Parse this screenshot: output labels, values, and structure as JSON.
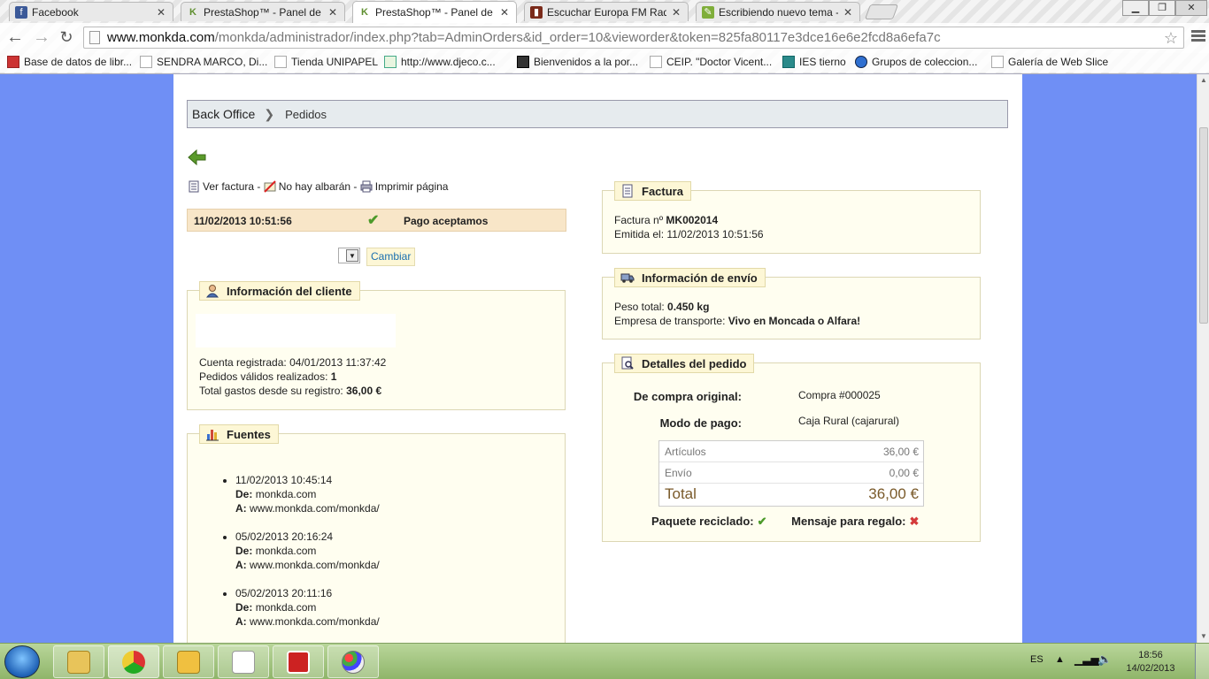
{
  "browser": {
    "tabs": [
      {
        "title": "Facebook",
        "icon": "facebook-icon",
        "color": "#3b5998",
        "glyph": "f"
      },
      {
        "title": "PrestaShop™ - Panel de ad",
        "icon": "prestashop-icon",
        "color": "#5f8f2f",
        "glyph": "K"
      },
      {
        "title": "PrestaShop™ - Panel de ad",
        "icon": "prestashop-icon",
        "color": "#5f8f2f",
        "glyph": "K"
      },
      {
        "title": "Escuchar Europa FM Radio",
        "icon": "radio-icon",
        "color": "#7a2a1a",
        "glyph": "▮"
      },
      {
        "title": "Escribiendo nuevo tema -",
        "icon": "forum-icon",
        "color": "#7fae3a",
        "glyph": "✎"
      }
    ],
    "url_host": "www.monkda.com",
    "url_rest": "/monkda/administrador/index.php?tab=AdminOrders&id_order=10&vieworder&token=825fa80117e3dce16e6e2fcd8a6efa7c",
    "bookmarks": [
      "Base de datos de libr...",
      "SENDRA MARCO, Di...",
      "Tienda UNIPAPEL",
      "http://www.djeco.c...",
      "Bienvenidos a la por...",
      "CEIP. \"Doctor Vicent...",
      "IES tierno",
      "Grupos de coleccion...",
      "Galería de Web Slice"
    ]
  },
  "page": {
    "breadcrumb": {
      "root": "Back Office",
      "current": "Pedidos"
    },
    "actions": {
      "invoice": "Ver factura",
      "sep1": " - ",
      "no_delivery": "No hay albarán",
      "sep2": " - ",
      "print": "Imprimir página"
    },
    "status": {
      "date": "11/02/2013 10:51:56",
      "label": "Pago aceptamos"
    },
    "change_button": "Cambiar",
    "customer": {
      "title": "Información del cliente",
      "registered_label": "Cuenta registrada:",
      "registered_value": "04/01/2013 11:37:42",
      "orders_label": "Pedidos válidos realizados:",
      "orders_value": "1",
      "spent_label": "Total gastos desde su registro:",
      "spent_value": "36,00 €"
    },
    "sources": {
      "title": "Fuentes",
      "from_label": "De:",
      "to_label": "A:",
      "items": [
        {
          "date": "11/02/2013 10:45:14",
          "from": "monkda.com",
          "to": "www.monkda.com/monkda/"
        },
        {
          "date": "05/02/2013 20:16:24",
          "from": "monkda.com",
          "to": "www.monkda.com/monkda/"
        },
        {
          "date": "05/02/2013 20:11:16",
          "from": "monkda.com",
          "to": "www.monkda.com/monkda/"
        }
      ]
    },
    "invoice": {
      "title": "Factura",
      "number_label": "Factura nº",
      "number_value": "MK002014",
      "issued_label": "Emitida el:",
      "issued_value": "11/02/2013 10:51:56"
    },
    "shipping": {
      "title": "Información de envío",
      "weight_label": "Peso total:",
      "weight_value": "0.450 kg",
      "carrier_label": "Empresa de transporte:",
      "carrier_value": "Vivo en Moncada o Alfara!"
    },
    "details": {
      "title": "Detalles del pedido",
      "original_label": "De compra original:",
      "original_value": "Compra #000025",
      "payment_label": "Modo de pago:",
      "payment_value": "Caja Rural (cajarural)",
      "totals": [
        {
          "label": "Artículos",
          "value": "36,00 €"
        },
        {
          "label": "Envío",
          "value": "0,00 €"
        },
        {
          "label": "Total",
          "value": "36,00 €"
        }
      ],
      "recycled_label": "Paquete reciclado:",
      "gift_label": "Mensaje para regalo:"
    }
  },
  "taskbar": {
    "lang": "ES",
    "time": "18:56",
    "date": "14/02/2013"
  },
  "colors": {
    "accent": "#1a6fb0",
    "ok": "#4c9a2a",
    "error": "#d43b3b",
    "box_bg": "#fffef0",
    "legend_bg": "#fdf7d6"
  }
}
